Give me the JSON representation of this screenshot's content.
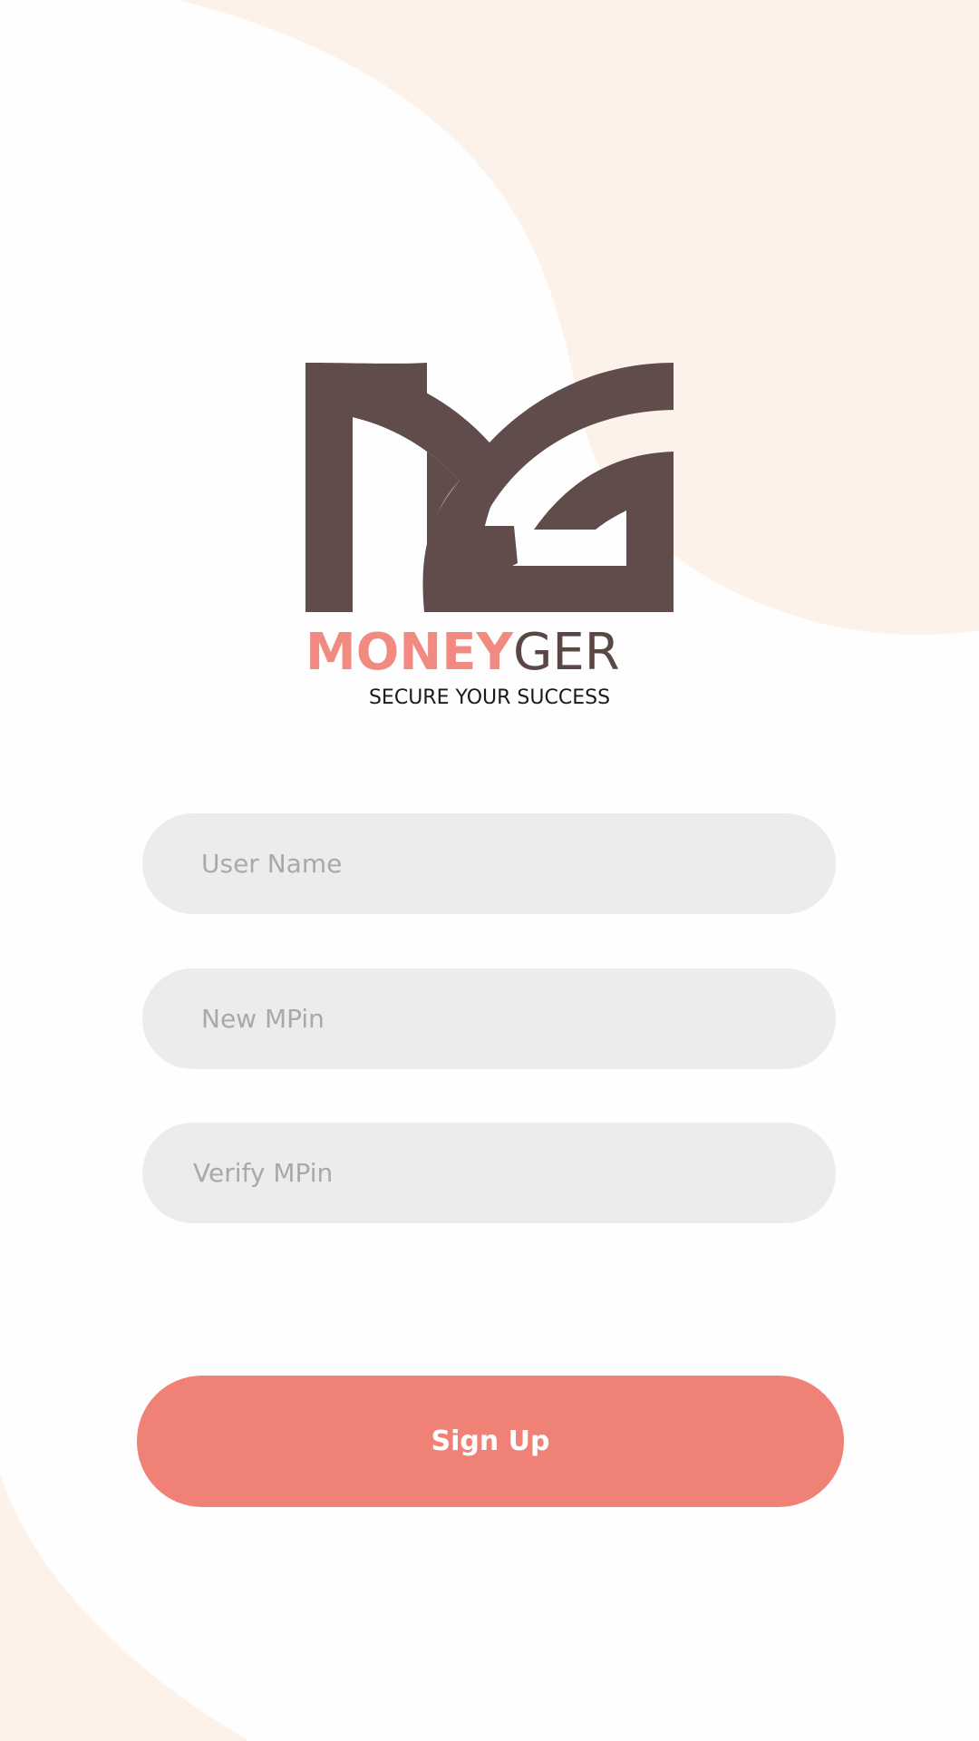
{
  "colors": {
    "background": "#fefefe",
    "blob": "#fdf2e9",
    "logo_dark": "#5a4644",
    "accent": "#f08176",
    "field_bg": "#ececec",
    "placeholder": "#a9a9a9",
    "button_text": "#ffffff"
  },
  "logo": {
    "mark_icon": "mg-monogram",
    "wordmark_bold": "MONEY",
    "wordmark_light": "GER",
    "tagline": "SECURE YOUR SUCCESS"
  },
  "form": {
    "username_placeholder": "User Name",
    "new_mpin_placeholder": "New MPin",
    "verify_mpin_placeholder": "Verify MPin",
    "signup_label": "Sign Up"
  }
}
